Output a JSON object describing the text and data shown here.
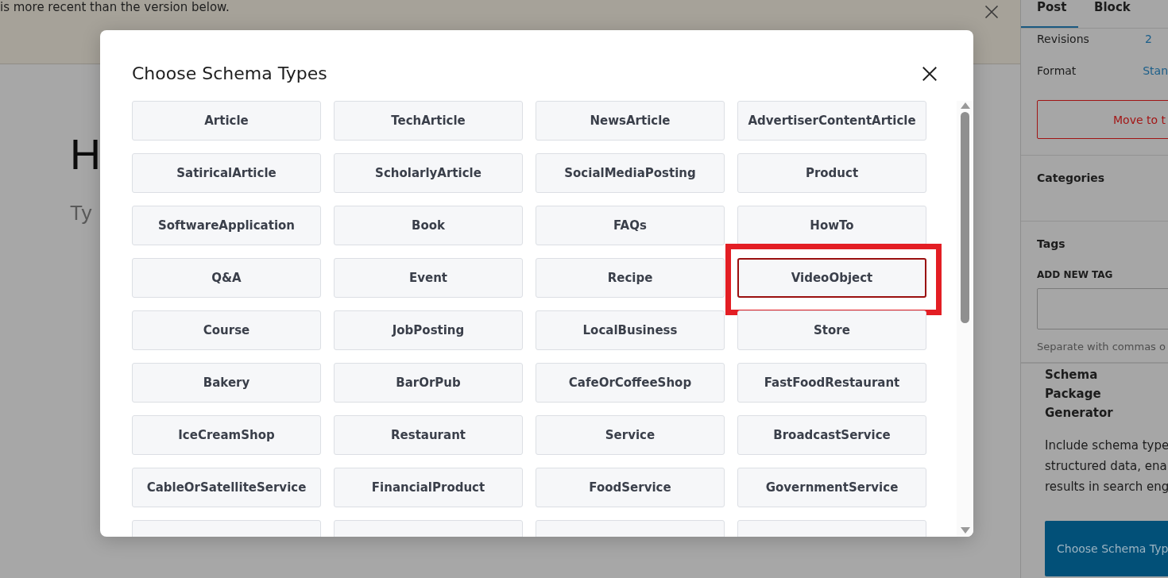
{
  "notice": {
    "text": "is more recent than the version below."
  },
  "editor": {
    "title": "H",
    "body": "Ty"
  },
  "sidebar": {
    "tabs": [
      {
        "label": "Post",
        "selected": true
      },
      {
        "label": "Block",
        "selected": false
      }
    ],
    "revisions": {
      "label": "Revisions",
      "value": "2"
    },
    "format": {
      "label": "Format",
      "value": "Stan"
    },
    "trash_button": "Move to t",
    "categories": "Categories",
    "tags": {
      "title": "Tags",
      "field_label": "ADD NEW TAG",
      "hint": "Separate with commas o"
    },
    "schema_panel": {
      "title": "Schema Package Generator",
      "lines": [
        "Include schema type",
        "structured data, ena",
        "results in search eng"
      ],
      "button": "Choose Schema Typ"
    }
  },
  "modal": {
    "title": "Choose Schema Types",
    "types": [
      {
        "label": "Article",
        "selected": false
      },
      {
        "label": "TechArticle",
        "selected": false
      },
      {
        "label": "NewsArticle",
        "selected": false
      },
      {
        "label": "AdvertiserContentArticle",
        "selected": false
      },
      {
        "label": "SatiricalArticle",
        "selected": false
      },
      {
        "label": "ScholarlyArticle",
        "selected": false
      },
      {
        "label": "SocialMediaPosting",
        "selected": false
      },
      {
        "label": "Product",
        "selected": false
      },
      {
        "label": "SoftwareApplication",
        "selected": false
      },
      {
        "label": "Book",
        "selected": false
      },
      {
        "label": "FAQs",
        "selected": false
      },
      {
        "label": "HowTo",
        "selected": false
      },
      {
        "label": "Q&A",
        "selected": false
      },
      {
        "label": "Event",
        "selected": false
      },
      {
        "label": "Recipe",
        "selected": false
      },
      {
        "label": "VideoObject",
        "selected": true
      },
      {
        "label": "Course",
        "selected": false
      },
      {
        "label": "JobPosting",
        "selected": false
      },
      {
        "label": "LocalBusiness",
        "selected": false
      },
      {
        "label": "Store",
        "selected": false
      },
      {
        "label": "Bakery",
        "selected": false
      },
      {
        "label": "BarOrPub",
        "selected": false
      },
      {
        "label": "CafeOrCoffeeShop",
        "selected": false
      },
      {
        "label": "FastFoodRestaurant",
        "selected": false
      },
      {
        "label": "IceCreamShop",
        "selected": false
      },
      {
        "label": "Restaurant",
        "selected": false
      },
      {
        "label": "Service",
        "selected": false
      },
      {
        "label": "BroadcastService",
        "selected": false
      },
      {
        "label": "CableOrSatelliteService",
        "selected": false
      },
      {
        "label": "FinancialProduct",
        "selected": false
      },
      {
        "label": "FoodService",
        "selected": false
      },
      {
        "label": "GovernmentService",
        "selected": false
      },
      {
        "selected": false
      },
      {
        "selected": false
      },
      {
        "selected": false
      },
      {
        "selected": false
      }
    ]
  }
}
